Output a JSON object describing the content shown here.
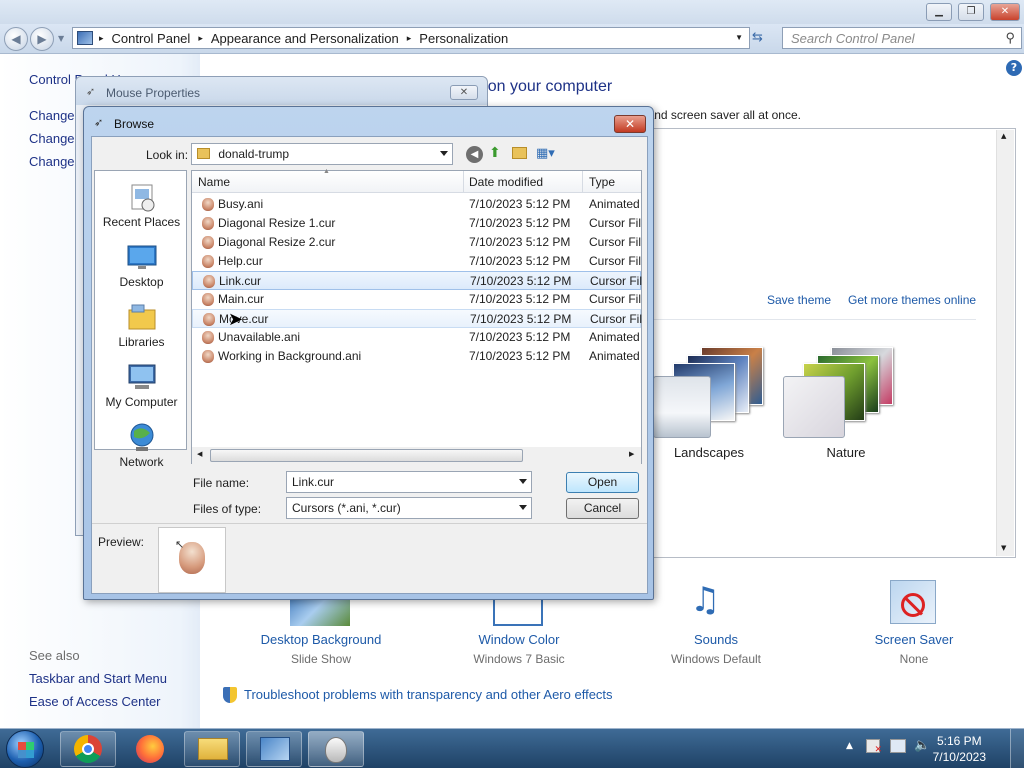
{
  "control_panel": {
    "breadcrumb": [
      "Control Panel",
      "Appearance and Personalization",
      "Personalization"
    ],
    "search_placeholder": "Search Control Panel",
    "left_top_link": "Control Panel Home",
    "left_links": [
      "Change desktop icons",
      "Change mouse pointers",
      "Change your account picture"
    ],
    "heading": "Change the visuals and sounds on your computer",
    "subheading": "Click a theme to change the desktop background, window color, sounds, and screen saver all at once.",
    "save_theme": "Save theme",
    "get_more_themes": "Get more themes online",
    "themes": [
      "Landscapes",
      "Nature"
    ],
    "bottom_items": [
      {
        "label": "Desktop Background",
        "sub": "Slide Show"
      },
      {
        "label": "Window Color",
        "sub": "Windows 7 Basic"
      },
      {
        "label": "Sounds",
        "sub": "Windows Default"
      },
      {
        "label": "Screen Saver",
        "sub": "None"
      }
    ],
    "troubleshoot": "Troubleshoot problems with transparency and other Aero effects",
    "see_also_label": "See also",
    "see_also": [
      "Taskbar and Start Menu",
      "Ease of Access Center"
    ]
  },
  "mouse_properties": {
    "title": "Mouse Properties"
  },
  "browse": {
    "title": "Browse",
    "look_in_label": "Look in:",
    "look_in_value": "donald-trump",
    "places": [
      "Recent Places",
      "Desktop",
      "Libraries",
      "My Computer",
      "Network"
    ],
    "columns": [
      "Name",
      "Date modified",
      "Type"
    ],
    "files": [
      {
        "name": "Busy.ani",
        "date": "7/10/2023 5:12 PM",
        "type": "Animated"
      },
      {
        "name": "Diagonal Resize 1.cur",
        "date": "7/10/2023 5:12 PM",
        "type": "Cursor File"
      },
      {
        "name": "Diagonal Resize 2.cur",
        "date": "7/10/2023 5:12 PM",
        "type": "Cursor File"
      },
      {
        "name": "Help.cur",
        "date": "7/10/2023 5:12 PM",
        "type": "Cursor File"
      },
      {
        "name": "Link.cur",
        "date": "7/10/2023 5:12 PM",
        "type": "Cursor File"
      },
      {
        "name": "Main.cur",
        "date": "7/10/2023 5:12 PM",
        "type": "Cursor File"
      },
      {
        "name": "Move.cur",
        "date": "7/10/2023 5:12 PM",
        "type": "Cursor File"
      },
      {
        "name": "Unavailable.ani",
        "date": "7/10/2023 5:12 PM",
        "type": "Animated"
      },
      {
        "name": "Working in Background.ani",
        "date": "7/10/2023 5:12 PM",
        "type": "Animated"
      }
    ],
    "selected_file": "Link.cur",
    "file_name_label": "File name:",
    "file_name_value": "Link.cur",
    "files_of_type_label": "Files of type:",
    "files_of_type_value": "Cursors (*.ani, *.cur)",
    "open_label": "Open",
    "cancel_label": "Cancel",
    "preview_label": "Preview:"
  },
  "taskbar": {
    "time": "5:16 PM",
    "date": "7/10/2023",
    "apps": [
      "start-orb",
      "chrome",
      "firefox",
      "file-explorer",
      "control-panel",
      "mouse"
    ]
  },
  "colors": {
    "link_blue": "#1e5aa8",
    "taskbar": "#2b5178",
    "selection": "#dceafb"
  }
}
